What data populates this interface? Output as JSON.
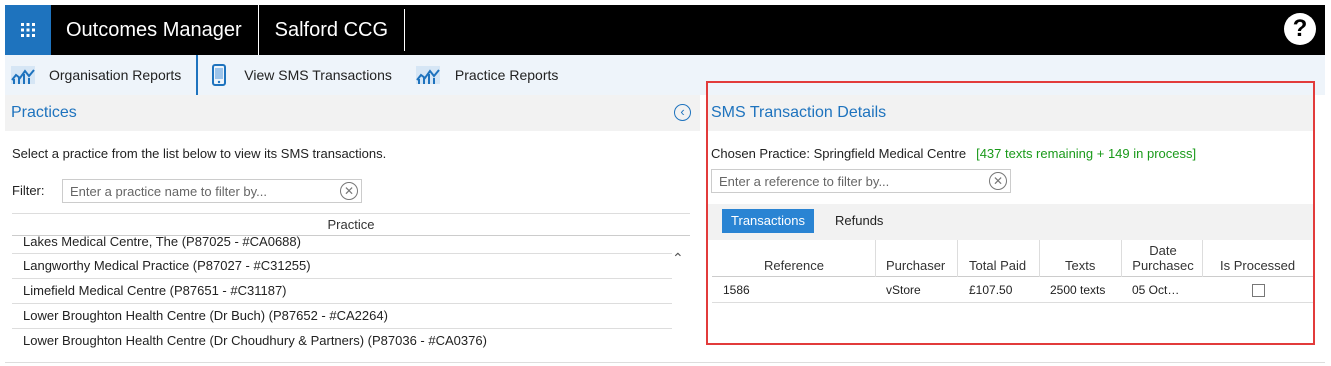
{
  "header": {
    "app_title": "Outcomes Manager",
    "org_title": "Salford CCG",
    "help_label": "?"
  },
  "nav": {
    "items": [
      {
        "label": "Organisation Reports",
        "icon": "bar-chart-icon"
      },
      {
        "label": "View SMS Transactions",
        "icon": "mobile-phone-icon"
      },
      {
        "label": "Practice Reports",
        "icon": "bar-chart-icon"
      }
    ]
  },
  "practices": {
    "title": "Practices",
    "intro": "Select a practice from the list below to view its SMS transactions.",
    "filter_label": "Filter:",
    "filter_placeholder": "Enter a practice name to filter by...",
    "column_header": "Practice",
    "rows": [
      "Lakes Medical Centre, The (P87025 - #CA0688)",
      "Langworthy Medical Practice (P87027 - #C31255)",
      "Limefield Medical Centre (P87651 - #C31187)",
      "Lower Broughton Health Centre (Dr Buch) (P87652 - #CA2264)",
      "Lower Broughton Health Centre (Dr Choudhury & Partners) (P87036 - #CA0376)"
    ]
  },
  "details": {
    "title": "SMS Transaction Details",
    "chosen_label": "Chosen Practice: Springfield Medical Centre",
    "remaining": "[437 texts remaining + 149 in process]",
    "ref_placeholder": "Enter a reference to filter by...",
    "tabs": [
      "Transactions",
      "Refunds"
    ],
    "columns": [
      "Reference",
      "Purchaser",
      "Total Paid",
      "Texts",
      "Date Purchasec",
      "Is Processed"
    ],
    "rows": [
      {
        "reference": "1586",
        "purchaser": "vStore",
        "total_paid": "£107.50",
        "texts": "2500 texts",
        "date": "05 Oct…",
        "is_processed": false
      }
    ]
  },
  "colors": {
    "accent": "#1e73be",
    "highlight_border": "#e23b3b",
    "status_green": "#1a9a1a"
  }
}
